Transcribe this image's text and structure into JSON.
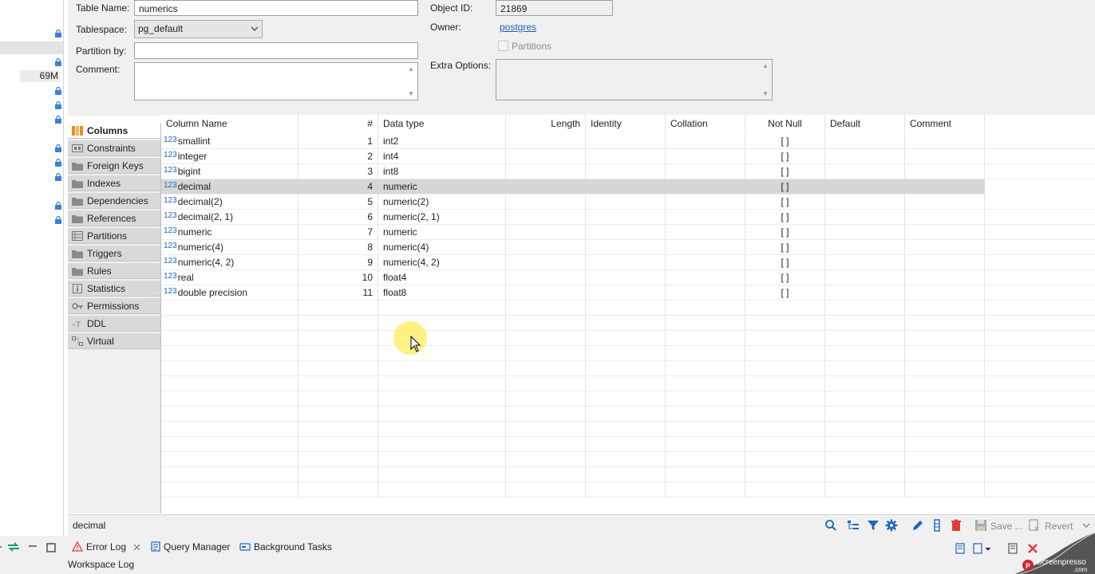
{
  "left_nav": {
    "size_label": "69M"
  },
  "properties": {
    "table_name_label": "Table Name:",
    "table_name_value": "numerics",
    "tablespace_label": "Tablespace:",
    "tablespace_value": "pg_default",
    "partition_by_label": "Partition by:",
    "partition_by_value": "",
    "comment_label": "Comment:",
    "object_id_label": "Object ID:",
    "object_id_value": "21869",
    "owner_label": "Owner:",
    "owner_value": "postgres",
    "partitions_label": "Partitions",
    "extra_options_label": "Extra Options:"
  },
  "tabs": [
    {
      "label": "Columns",
      "icon": "columns-icon",
      "active": true
    },
    {
      "label": "Constraints",
      "icon": "constraints-icon"
    },
    {
      "label": "Foreign Keys",
      "icon": "folder-icon"
    },
    {
      "label": "Indexes",
      "icon": "folder-icon"
    },
    {
      "label": "Dependencies",
      "icon": "folder-icon"
    },
    {
      "label": "References",
      "icon": "folder-icon"
    },
    {
      "label": "Partitions",
      "icon": "partitions-icon"
    },
    {
      "label": "Triggers",
      "icon": "folder-icon"
    },
    {
      "label": "Rules",
      "icon": "folder-icon"
    },
    {
      "label": "Statistics",
      "icon": "info-icon"
    },
    {
      "label": "Permissions",
      "icon": "key-icon"
    },
    {
      "label": "DDL",
      "icon": "ddl-icon"
    },
    {
      "label": "Virtual",
      "icon": "virtual-icon"
    }
  ],
  "grid": {
    "headers": [
      "Column Name",
      "#",
      "Data type",
      "Length",
      "Identity",
      "Collation",
      "Not Null",
      "Default",
      "Comment"
    ],
    "type_badge": "123",
    "rows": [
      {
        "name": "smallint",
        "num": "1",
        "type": "int2",
        "not_null": "[ ]"
      },
      {
        "name": "integer",
        "num": "2",
        "type": "int4",
        "not_null": "[ ]"
      },
      {
        "name": "bigint",
        "num": "3",
        "type": "int8",
        "not_null": "[ ]"
      },
      {
        "name": "decimal",
        "num": "4",
        "type": "numeric",
        "not_null": "[ ]",
        "selected": true
      },
      {
        "name": "decimal(2)",
        "num": "5",
        "type": "numeric(2)",
        "not_null": "[ ]"
      },
      {
        "name": "decimal(2, 1)",
        "num": "6",
        "type": "numeric(2, 1)",
        "not_null": "[ ]"
      },
      {
        "name": "numeric",
        "num": "7",
        "type": "numeric",
        "not_null": "[ ]"
      },
      {
        "name": "numeric(4)",
        "num": "8",
        "type": "numeric(4)",
        "not_null": "[ ]"
      },
      {
        "name": "numeric(4, 2)",
        "num": "9",
        "type": "numeric(4, 2)",
        "not_null": "[ ]"
      },
      {
        "name": "real",
        "num": "10",
        "type": "float4",
        "not_null": "[ ]"
      },
      {
        "name": "double precision",
        "num": "11",
        "type": "float8",
        "not_null": "[ ]"
      }
    ]
  },
  "status": {
    "selected_text": "decimal",
    "save_label": "Save ...",
    "revert_label": "Revert"
  },
  "bottom": {
    "tabs": [
      {
        "label": "Error Log",
        "icon": "warning-icon"
      },
      {
        "label": "Query Manager",
        "icon": "query-manager-icon"
      },
      {
        "label": "Background Tasks",
        "icon": "background-tasks-icon"
      }
    ],
    "workspace_log": "Workspace Log"
  },
  "watermark": {
    "text": "Screenpresso",
    "sub": ".com"
  },
  "colors": {
    "accent": "#1a66c6",
    "selection": "#d6d6d6",
    "panel": "#f0f0f0",
    "link": "#1a5fb4"
  }
}
